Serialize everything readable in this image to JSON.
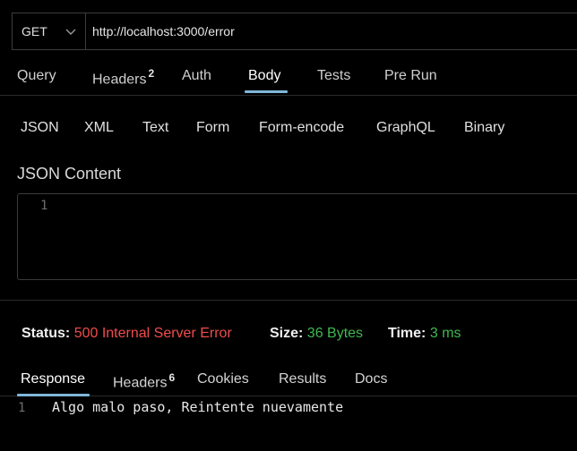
{
  "request": {
    "method": "GET",
    "url": "http://localhost:3000/error"
  },
  "tabs": [
    {
      "label": "Query",
      "badge": ""
    },
    {
      "label": "Headers",
      "badge": "2"
    },
    {
      "label": "Auth",
      "badge": ""
    },
    {
      "label": "Body",
      "badge": ""
    },
    {
      "label": "Tests",
      "badge": ""
    },
    {
      "label": "Pre Run",
      "badge": ""
    }
  ],
  "active_tab": "Body",
  "body_types": [
    "JSON",
    "XML",
    "Text",
    "Form",
    "Form-encode",
    "GraphQL",
    "Binary"
  ],
  "json_content": {
    "title": "JSON Content",
    "line_number": "1"
  },
  "status": {
    "status_label": "Status:",
    "status_value": "500 Internal Server Error",
    "size_label": "Size:",
    "size_value": "36 Bytes",
    "time_label": "Time:",
    "time_value": "3 ms"
  },
  "response_tabs": [
    {
      "label": "Response",
      "badge": ""
    },
    {
      "label": "Headers",
      "badge": "6"
    },
    {
      "label": "Cookies",
      "badge": ""
    },
    {
      "label": "Results",
      "badge": ""
    },
    {
      "label": "Docs",
      "badge": ""
    }
  ],
  "active_response_tab": "Response",
  "response_body": {
    "line_number": "1",
    "text": "Algo malo paso, Reintente nuevamente"
  },
  "colors": {
    "accent_underline": "#7fb6d8",
    "error": "#f14c4c",
    "success": "#3fb950"
  },
  "icons": {
    "method_dropdown": "chevron-down-icon"
  }
}
